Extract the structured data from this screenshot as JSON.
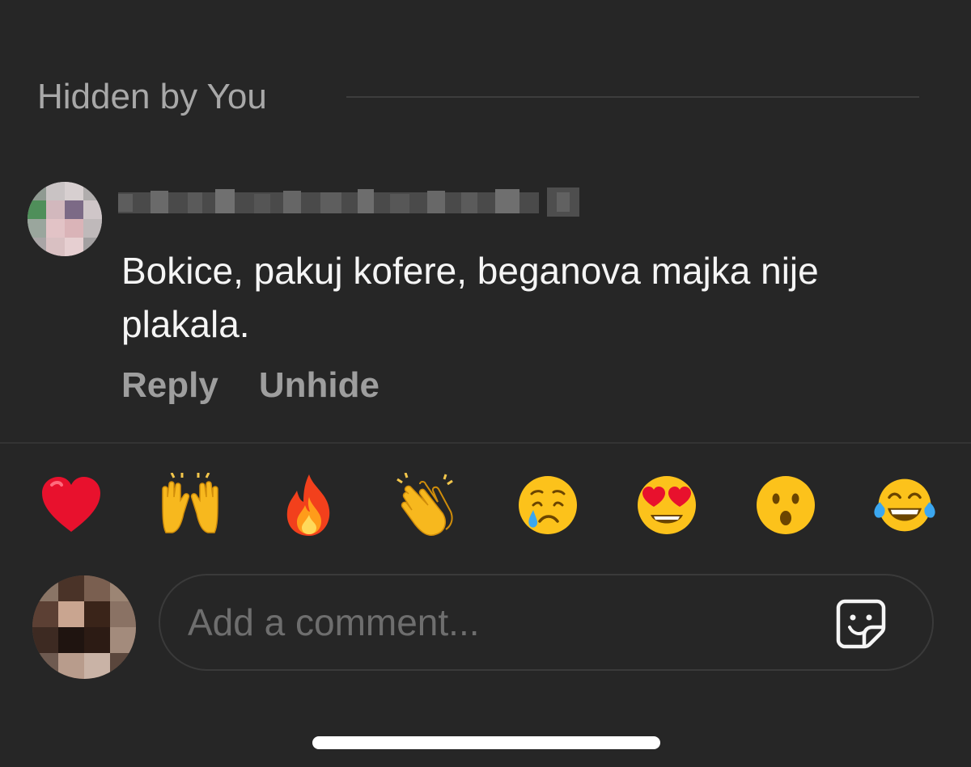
{
  "top_cutoff_text": "",
  "hidden_section": {
    "title": "Hidden by You"
  },
  "comment": {
    "text": "Bokice, pakuj kofere, beganova majka nije plakala.",
    "reply_label": "Reply",
    "unhide_label": "Unhide"
  },
  "reactions": [
    {
      "name": "heart",
      "glyph": "❤️"
    },
    {
      "name": "raising-hands",
      "glyph": "🙌"
    },
    {
      "name": "fire",
      "glyph": "🔥"
    },
    {
      "name": "clapping-hands",
      "glyph": "👏"
    },
    {
      "name": "crying-face",
      "glyph": "😢"
    },
    {
      "name": "heart-eyes",
      "glyph": "😍"
    },
    {
      "name": "surprised-face",
      "glyph": "😮"
    },
    {
      "name": "tears-of-joy",
      "glyph": "😂"
    }
  ],
  "composer": {
    "placeholder": "Add a comment...",
    "sticker_icon": "sticker-icon"
  },
  "colors": {
    "background": "#262626",
    "muted_text": "#a8a8a8",
    "primary_text": "#f5f5f5"
  }
}
